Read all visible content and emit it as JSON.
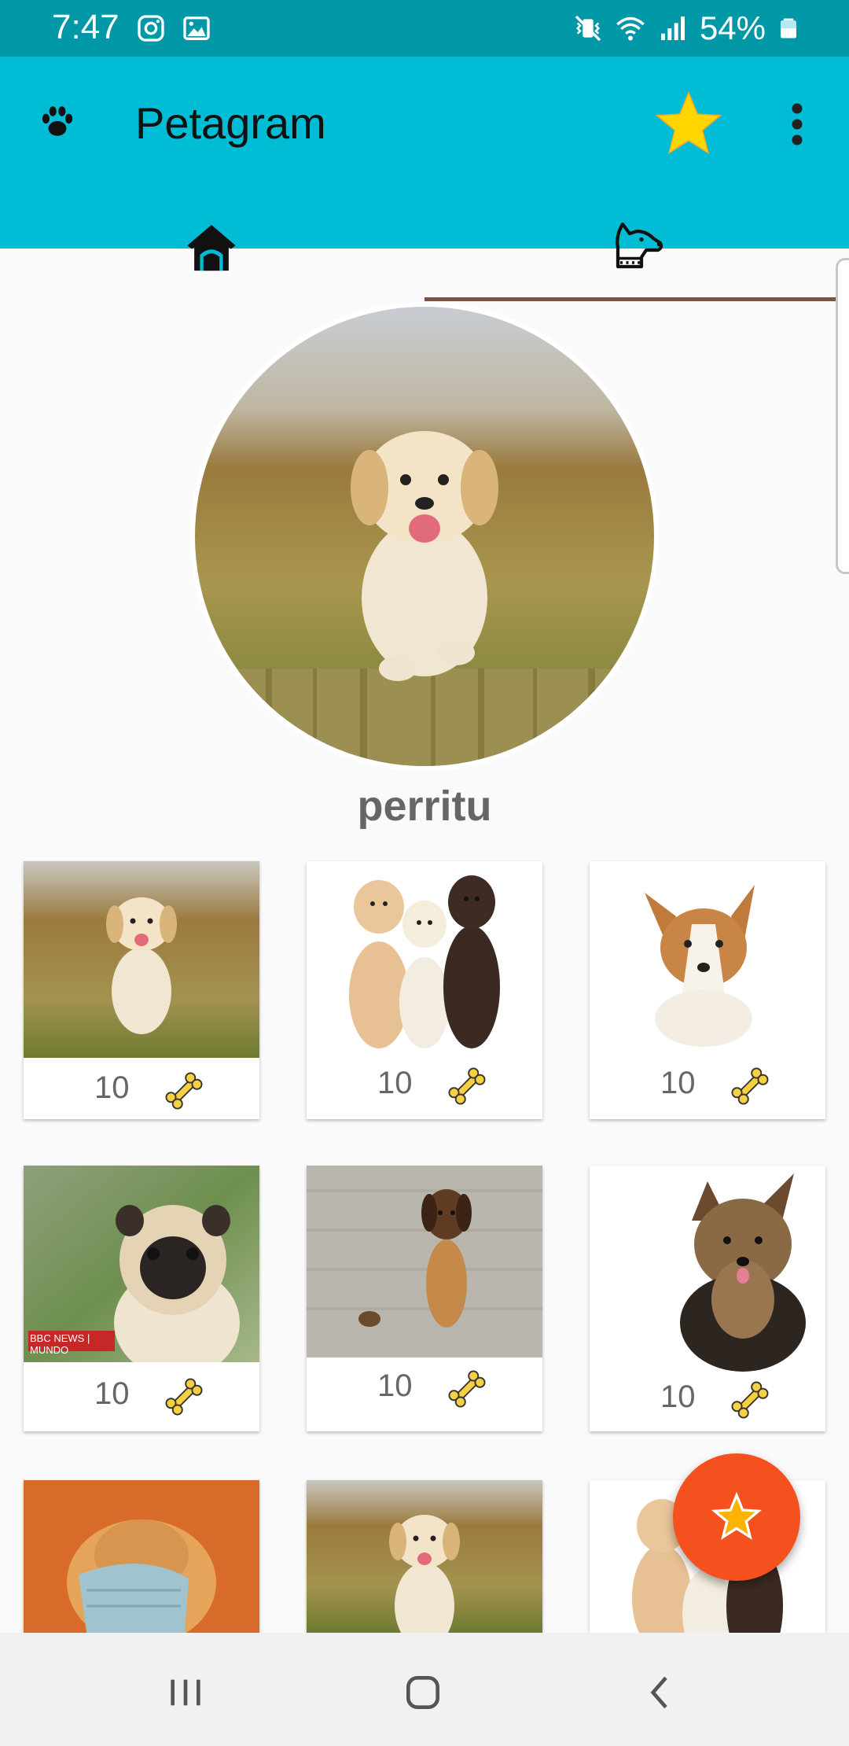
{
  "status_bar": {
    "time": "7:47",
    "battery": "54%",
    "bg_color": "#0097a7"
  },
  "app_bar": {
    "title": "Petagram",
    "bg_color": "#00bcd4",
    "logo_icon": "paw-icon",
    "favorites_icon": "star-icon",
    "menu_icon": "more-vert-icon"
  },
  "tabs": [
    {
      "name": "home",
      "icon": "doghouse-icon",
      "selected": false
    },
    {
      "name": "profile",
      "icon": "dog-head-icon",
      "selected": true
    }
  ],
  "indicator_color": "#795548",
  "profile": {
    "name": "perritu"
  },
  "grid": [
    {
      "count": "10",
      "photo": "golden-puppy-running"
    },
    {
      "count": "10",
      "photo": "three-labrador-puppies"
    },
    {
      "count": "10",
      "photo": "corgi-puppy"
    },
    {
      "count": "10",
      "photo": "pug-bbc-news"
    },
    {
      "count": "10",
      "photo": "brown-puppy-on-carpet"
    },
    {
      "count": "10",
      "photo": "yorkshire-terrier"
    },
    {
      "count": "",
      "photo": "dog-with-mask"
    },
    {
      "count": "",
      "photo": "golden-puppy-running"
    },
    {
      "count": "",
      "photo": "three-labrador-puppies"
    }
  ],
  "photo_badge": "BBC NEWS | MUNDO",
  "fab": {
    "icon": "star-icon",
    "color": "#f4511e"
  },
  "nav_bar": {
    "buttons": [
      "recents",
      "home",
      "back"
    ]
  }
}
